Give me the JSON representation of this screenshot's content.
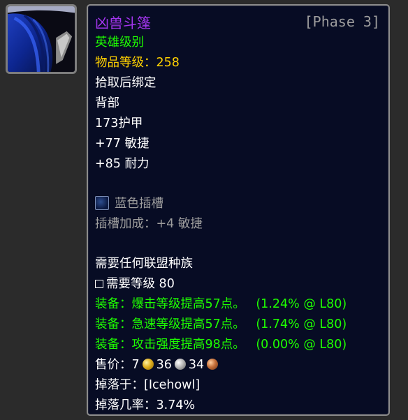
{
  "item": {
    "icon": "cloak-icon",
    "name": "凶兽斗篷",
    "phase": "[Phase 3]",
    "quality": "英雄级别",
    "item_level_label": "物品等级：",
    "item_level": "258",
    "binding": "拾取后绑定",
    "slot": "背部",
    "armor": "173护甲",
    "stat_agility": "+77 敏捷",
    "stat_stamina": "+85 耐力",
    "socket_label": "蓝色插槽",
    "socket_bonus": "插槽加成：+4 敏捷",
    "requirement_race": "需要任何联盟种族",
    "requirement_level": "需要等级 80",
    "equip_effects": [
      {
        "text": "装备：爆击等级提高57点。",
        "pct": "(1.24% @ L80)"
      },
      {
        "text": "装备：急速等级提高57点。",
        "pct": "(1.74% @ L80)"
      },
      {
        "text": "装备：攻击强度提高98点。",
        "pct": "(0.00% @ L80)"
      }
    ],
    "sell_price_label": "售价：",
    "sell_gold": "7",
    "sell_silver": "36",
    "sell_copper": "34",
    "dropped_by_label": "掉落于：",
    "dropped_by": "[Icehowl]",
    "drop_rate_label": "掉落几率：",
    "drop_rate": "3.74%"
  },
  "colors": {
    "epic": "#a335ee",
    "uncommon": "#1eff00",
    "gold": "#ffd100",
    "grey": "#9d9d9d",
    "tooltip_bg": "#070c24"
  }
}
